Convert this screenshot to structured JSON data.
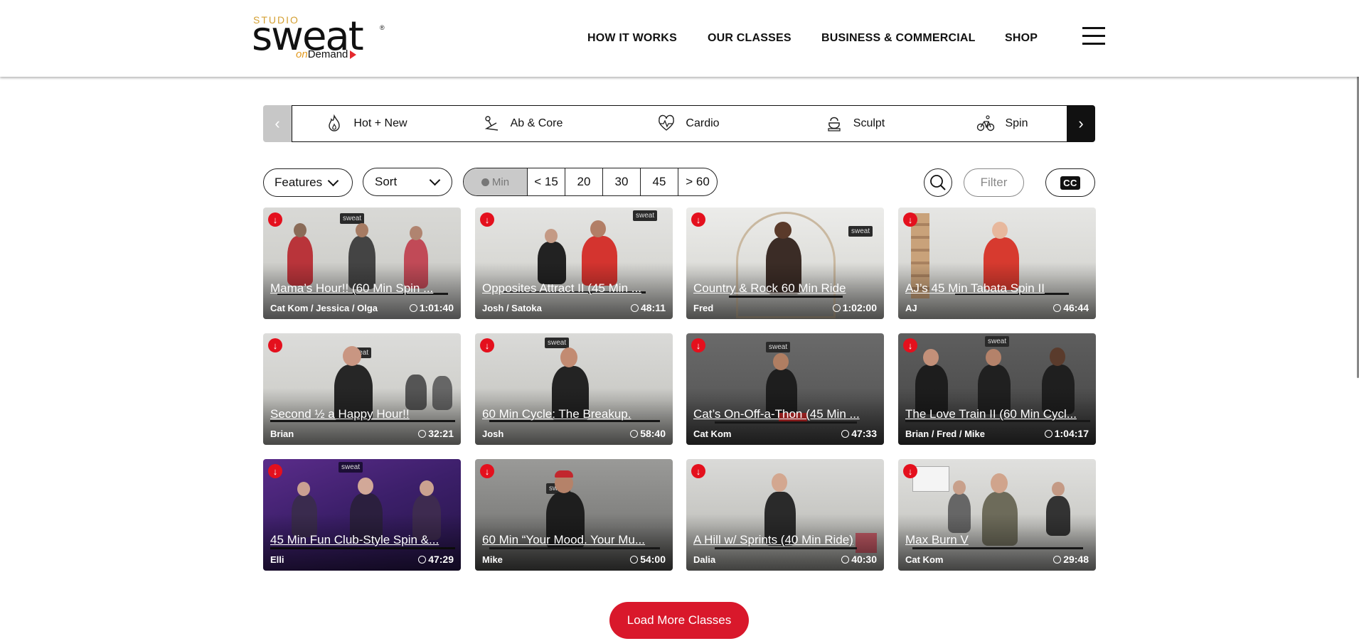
{
  "brand": {
    "studio": "STUDIO",
    "sweat": "sweat",
    "reg": "®",
    "on": "on",
    "demand": "Demand"
  },
  "nav": [
    {
      "label": "HOW IT WORKS"
    },
    {
      "label": "OUR CLASSES"
    },
    {
      "label": "BUSINESS & COMMERCIAL"
    },
    {
      "label": "SHOP"
    }
  ],
  "categories": [
    {
      "label": "Hot + New",
      "icon": "flame-icon"
    },
    {
      "label": "Ab & Core",
      "icon": "situp-icon"
    },
    {
      "label": "Cardio",
      "icon": "heartbeat-icon"
    },
    {
      "label": "Sculpt",
      "icon": "kettlebell-icon"
    },
    {
      "label": "Spin",
      "icon": "bike-icon"
    }
  ],
  "filters": {
    "features_label": "Features",
    "sort_label": "Sort",
    "duration_label": "Min",
    "durations": [
      "< 15",
      "20",
      "30",
      "45",
      "> 60"
    ],
    "filter_placeholder": "Filter",
    "cc_label": "CC"
  },
  "classes": [
    {
      "title": "Mama’s Hour!! (60 Min Spin ...",
      "instructors": "Cat Kom / Jessica / Olga",
      "duration": "1:01:40"
    },
    {
      "title": "Opposites Attract II (45 Min ...",
      "instructors": "Josh / Satoka",
      "duration": "48:11"
    },
    {
      "title": "Country & Rock 60 Min Ride",
      "instructors": "Fred",
      "duration": "1:02:00"
    },
    {
      "title": "AJ’s 45 Min Tabata Spin II",
      "instructors": "AJ",
      "duration": "46:44"
    },
    {
      "title": "Second ½ a Happy Hour!!",
      "instructors": "Brian",
      "duration": "32:21"
    },
    {
      "title": "60 Min Cycle: The Breakup.",
      "instructors": "Josh",
      "duration": "58:40"
    },
    {
      "title": "Cat’s On-Off-a-Thon (45 Min ...",
      "instructors": "Cat Kom",
      "duration": "47:33"
    },
    {
      "title": "The Love Train II (60 Min Cycl...",
      "instructors": "Brian / Fred / Mike",
      "duration": "1:04:17"
    },
    {
      "title": "45 Min Fun Club-Style Spin &...",
      "instructors": "Elli",
      "duration": "47:29"
    },
    {
      "title": "60 Min “Your Mood. Your Mu...",
      "instructors": "Mike",
      "duration": "54:00"
    },
    {
      "title": "A Hill w/ Sprints (40 Min Ride)",
      "instructors": "Dalia",
      "duration": "40:30"
    },
    {
      "title": "Max Burn V",
      "instructors": "Cat Kom",
      "duration": "29:48"
    }
  ],
  "load_more_label": "Load More Classes"
}
